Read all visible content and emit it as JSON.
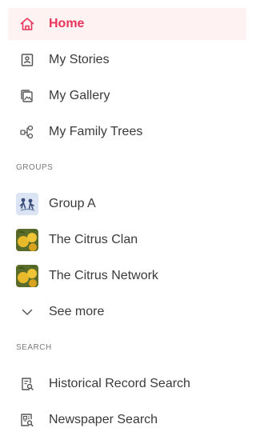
{
  "nav": {
    "home": "Home",
    "my_stories": "My Stories",
    "my_gallery": "My Gallery",
    "my_family_trees": "My Family Trees"
  },
  "groups": {
    "heading": "GROUPS",
    "items": [
      "Group A",
      "The Citrus Clan",
      "The Citrus Network"
    ],
    "see_more": "See more"
  },
  "search": {
    "heading": "SEARCH",
    "historical_record_search": "Historical Record Search",
    "newspaper_search": "Newspaper Search"
  },
  "colors": {
    "accent": "#e8345a",
    "active_background": "#fff2f2"
  },
  "icons": {
    "home": "home-icon",
    "my_stories": "stories-icon",
    "my_gallery": "gallery-icon",
    "my_family_trees": "family-tree-icon",
    "see_more": "chevron-down-icon",
    "historical_record_search": "record-search-icon",
    "newspaper_search": "newspaper-search-icon"
  }
}
